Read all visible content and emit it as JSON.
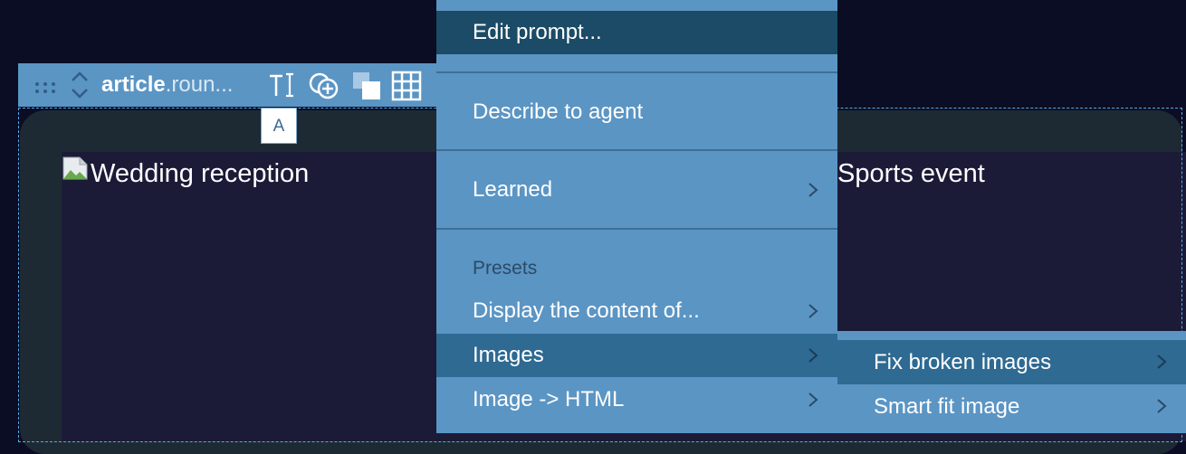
{
  "cards": [
    {
      "title": "Wedding reception"
    },
    {
      "title": "Sports event"
    }
  ],
  "toolbar": {
    "element_tag": "article",
    "element_class": ".roun...",
    "tooltip": "A"
  },
  "menu": {
    "edit_prompt": "Edit prompt...",
    "describe_to_agent": "Describe to agent",
    "learned": "Learned",
    "presets_label": "Presets",
    "display_content": "Display the content of...",
    "images": "Images",
    "image_to_html": "Image -> HTML"
  },
  "submenu": {
    "fix_broken_images": "Fix broken images",
    "smart_fit_image": "Smart fit image"
  }
}
